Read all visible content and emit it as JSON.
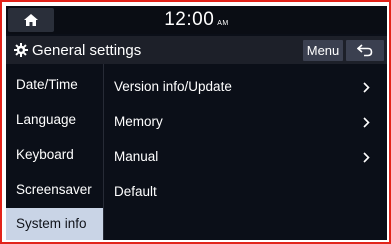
{
  "status_bar": {
    "time": "12:00",
    "ampm": "AM",
    "home_icon": "home-icon"
  },
  "header": {
    "icon": "gear-icon",
    "title": "General settings",
    "menu_label": "Menu",
    "back_icon": "back-arrow-icon"
  },
  "sidebar": {
    "items": [
      {
        "label": "Date/Time",
        "active": false
      },
      {
        "label": "Language",
        "active": false
      },
      {
        "label": "Keyboard",
        "active": false
      },
      {
        "label": "Screensaver",
        "active": false
      },
      {
        "label": "System info",
        "active": true
      }
    ]
  },
  "main": {
    "rows": [
      {
        "label": "Version info/Update",
        "has_chevron": true
      },
      {
        "label": "Memory",
        "has_chevron": true
      },
      {
        "label": "Manual",
        "has_chevron": true
      },
      {
        "label": "Default",
        "has_chevron": false
      }
    ]
  },
  "colors": {
    "frame_border": "#e2231a",
    "background": "#0b0f18",
    "active_item": "#c9d4e6",
    "button": "#3b4050"
  }
}
